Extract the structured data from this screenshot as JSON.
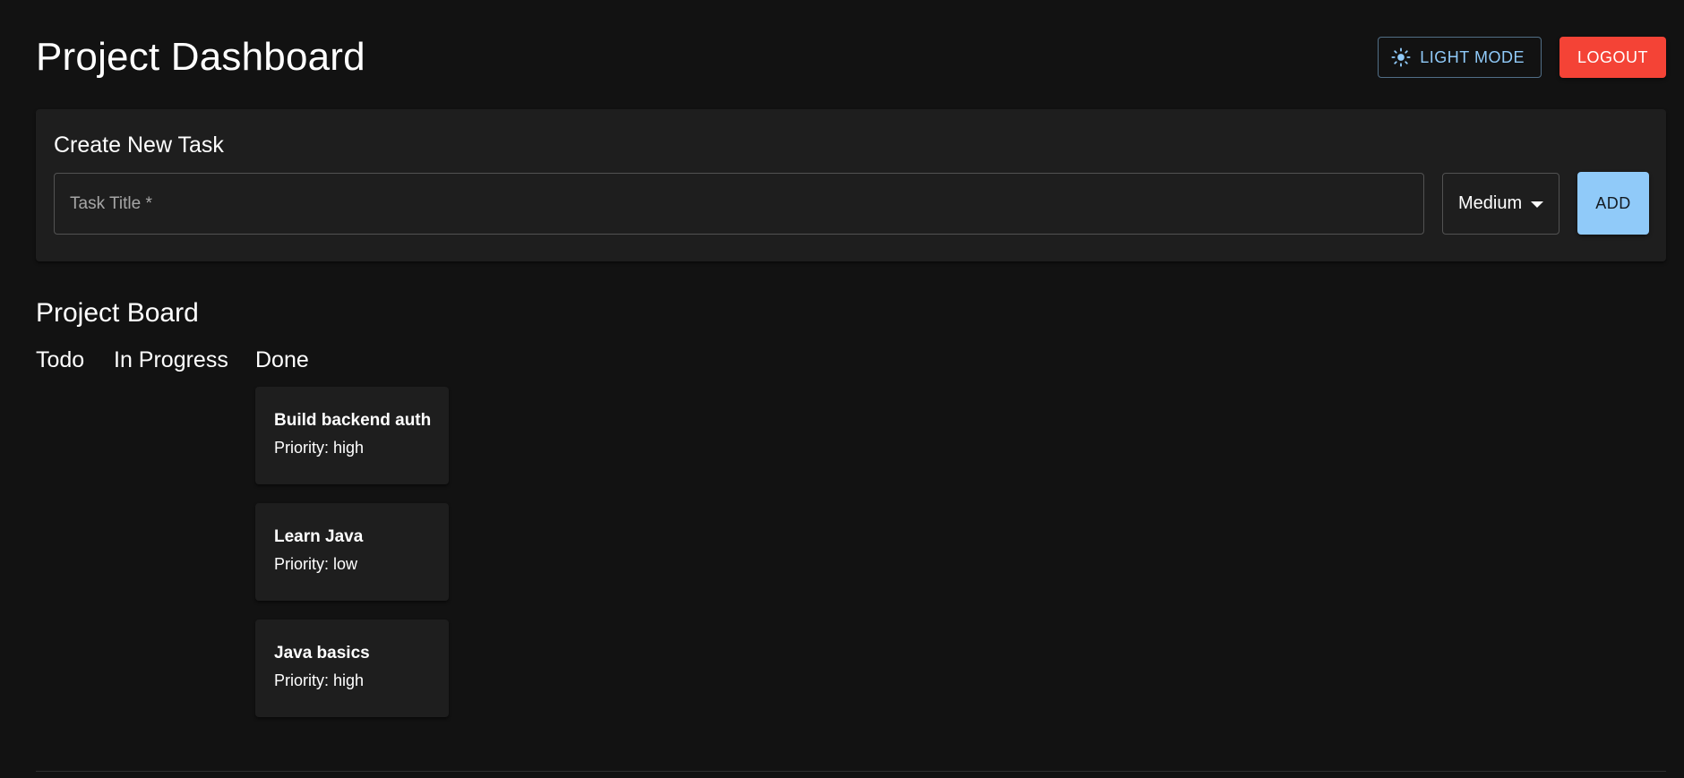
{
  "header": {
    "title": "Project Dashboard",
    "theme_toggle_label": "LIGHT MODE",
    "theme_toggle_icon": "sun-icon",
    "logout_label": "LOGOUT"
  },
  "create_task": {
    "title": "Create New Task",
    "task_title_placeholder": "Task Title *",
    "task_title_value": "",
    "priority_selected": "Medium",
    "add_label": "ADD"
  },
  "board": {
    "title": "Project Board",
    "columns": [
      {
        "label": "Todo",
        "tasks": []
      },
      {
        "label": "In Progress",
        "tasks": []
      },
      {
        "label": "Done",
        "tasks": [
          {
            "title": "Build backend auth",
            "priority": "Priority: high"
          },
          {
            "title": "Learn Java",
            "priority": "Priority: low"
          },
          {
            "title": "Java basics",
            "priority": "Priority: high"
          }
        ]
      }
    ]
  },
  "colors": {
    "background": "#121212",
    "surface": "#1e1e1e",
    "primary": "#90caf9",
    "danger": "#f44336",
    "text": "#ffffff"
  }
}
